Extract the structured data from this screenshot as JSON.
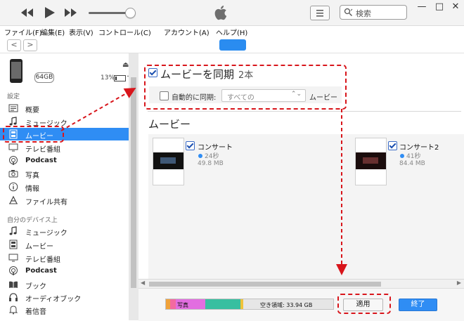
{
  "window": {
    "search_placeholder": "検索",
    "min": "—",
    "max": "□",
    "close": "✕"
  },
  "menubar": {
    "items": [
      "ファイル(F)",
      "編集(E)",
      "表示(V)",
      "コントロール(C)",
      "アカウント(A)",
      "ヘルプ(H)"
    ]
  },
  "navbar": {
    "back": "<",
    "forward": ">"
  },
  "device": {
    "capacity": "64GB",
    "battery_pct": "13%",
    "battery_level": 0.13,
    "charge": "+"
  },
  "sidebar": {
    "settings_label": "設定",
    "items": [
      {
        "label": "概要",
        "icon": "summary-icon"
      },
      {
        "label": "ミュージック",
        "icon": "music-note-icon"
      },
      {
        "label": "ムービー",
        "icon": "film-icon",
        "selected": true
      },
      {
        "label": "テレビ番組",
        "icon": "tv-icon"
      },
      {
        "label": "Podcast",
        "icon": "podcast-icon"
      },
      {
        "label": "写真",
        "icon": "camera-icon"
      },
      {
        "label": "情報",
        "icon": "info-icon"
      },
      {
        "label": "ファイル共有",
        "icon": "app-share-icon"
      }
    ],
    "on_device_label": "自分のデバイス上",
    "device_items": [
      {
        "label": "ミュージック",
        "icon": "music-note-icon"
      },
      {
        "label": "ムービー",
        "icon": "film-icon"
      },
      {
        "label": "テレビ番組",
        "icon": "tv-icon"
      },
      {
        "label": "Podcast",
        "icon": "podcast-icon"
      },
      {
        "label": "ブック",
        "icon": "book-icon"
      },
      {
        "label": "オーディオブック",
        "icon": "audiobook-icon"
      },
      {
        "label": "着信音",
        "icon": "bell-icon"
      }
    ]
  },
  "sync": {
    "title": "ムービーを同期",
    "count": "2本",
    "checked": true
  },
  "auto_sync": {
    "label": "自動的に同期:",
    "dropdown_value": "すべての",
    "suffix": "ムービー",
    "checked": false
  },
  "movies_section": {
    "title": "ムービー",
    "items": [
      {
        "title": "コンサート",
        "duration": "24秒",
        "size": "49.8 MB",
        "checked": true
      },
      {
        "title": "コンサート2",
        "duration": "41秒",
        "size": "84.4 MB",
        "checked": true
      }
    ]
  },
  "footer": {
    "photos_label": "写真",
    "free_space": "空き領域: 33.94 GB",
    "apply": "適用",
    "done": "終了"
  },
  "colors": {
    "accent": "#2f8df4",
    "annotation": "#d8151b"
  }
}
